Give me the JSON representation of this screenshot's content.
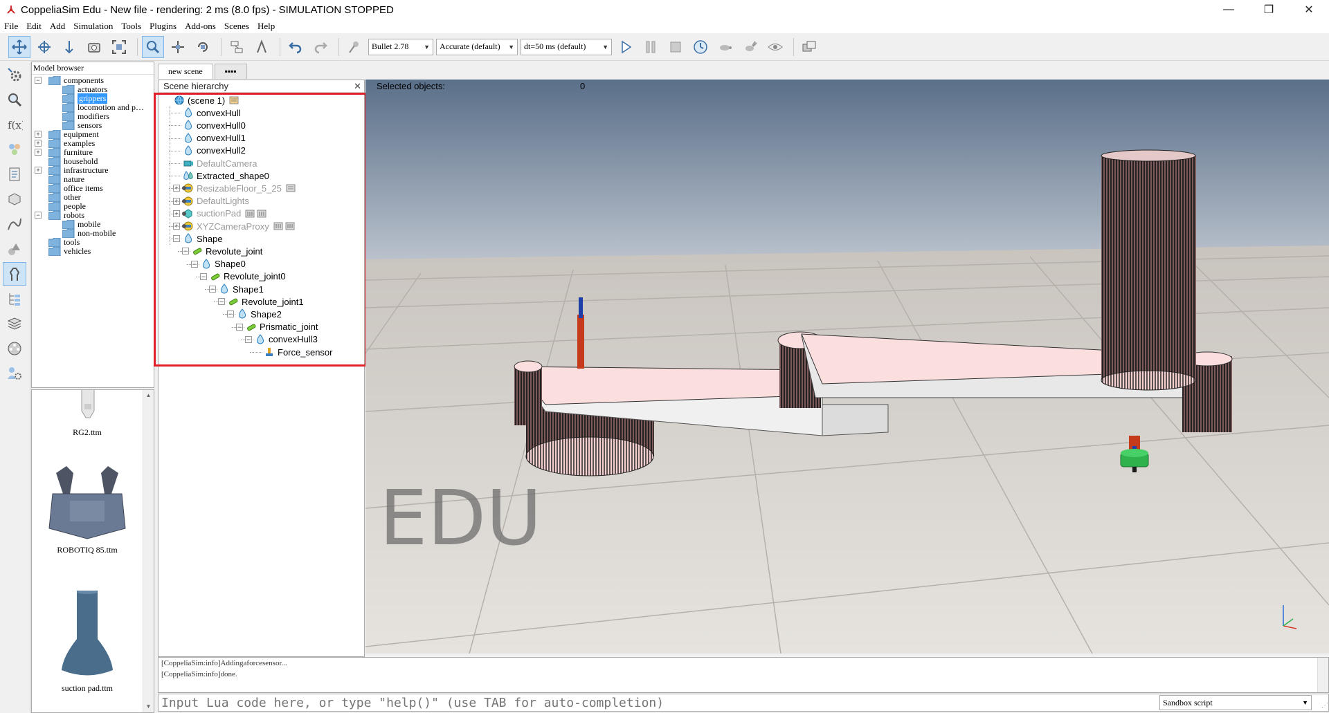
{
  "window": {
    "title": "CoppeliaSim Edu - New file - rendering: 2 ms (8.0 fps) - SIMULATION STOPPED",
    "minimize": "—",
    "maximize": "❐",
    "close": "✕"
  },
  "menu": [
    "File",
    "Edit",
    "Add",
    "Simulation",
    "Tools",
    "Plugins",
    "Add-ons",
    "Scenes",
    "Help"
  ],
  "toolbar": {
    "engine": "Bullet 2.78",
    "accuracy": "Accurate (default)",
    "timestep": "dt=50 ms (default)"
  },
  "model_browser": {
    "header": "Model browser",
    "items": [
      {
        "label": "components",
        "level": 0,
        "expanded": true
      },
      {
        "label": "actuators",
        "level": 1
      },
      {
        "label": "grippers",
        "level": 1,
        "selected": true
      },
      {
        "label": "locomotion and p…",
        "level": 1
      },
      {
        "label": "modifiers",
        "level": 1
      },
      {
        "label": "sensors",
        "level": 1
      },
      {
        "label": "equipment",
        "level": 0,
        "expander": "+"
      },
      {
        "label": "examples",
        "level": 0,
        "expander": "+"
      },
      {
        "label": "furniture",
        "level": 0,
        "expander": "+"
      },
      {
        "label": "household",
        "level": 0
      },
      {
        "label": "infrastructure",
        "level": 0,
        "expander": "+"
      },
      {
        "label": "nature",
        "level": 0
      },
      {
        "label": "office items",
        "level": 0
      },
      {
        "label": "other",
        "level": 0
      },
      {
        "label": "people",
        "level": 0
      },
      {
        "label": "robots",
        "level": 0,
        "expander": "-"
      },
      {
        "label": "mobile",
        "level": 1
      },
      {
        "label": "non-mobile",
        "level": 1
      },
      {
        "label": "tools",
        "level": 0
      },
      {
        "label": "vehicles",
        "level": 0
      }
    ]
  },
  "thumbnails": [
    {
      "label": "RG2.ttm"
    },
    {
      "label": "ROBOTIQ 85.ttm"
    },
    {
      "label": "suction pad.ttm"
    }
  ],
  "tabs": [
    {
      "label": "new scene",
      "active": true
    },
    {
      "label": "▪▪▪▪",
      "active": false
    }
  ],
  "scene_hierarchy": {
    "header": "Scene hierarchy",
    "items": [
      {
        "label": "(scene 1)",
        "depth": 0,
        "icon": "globe"
      },
      {
        "label": "convexHull",
        "depth": 1,
        "icon": "shape"
      },
      {
        "label": "convexHull0",
        "depth": 1,
        "icon": "shape"
      },
      {
        "label": "convexHull1",
        "depth": 1,
        "icon": "shape"
      },
      {
        "label": "convexHull2",
        "depth": 1,
        "icon": "shape"
      },
      {
        "label": "DefaultCamera",
        "depth": 1,
        "icon": "camera",
        "dim": true
      },
      {
        "label": "Extracted_shape0",
        "depth": 1,
        "icon": "shape-multi"
      },
      {
        "label": "ResizableFloor_5_25",
        "depth": 1,
        "icon": "model",
        "dim": true,
        "expander": "+"
      },
      {
        "label": "DefaultLights",
        "depth": 1,
        "icon": "model",
        "dim": true,
        "expander": "+"
      },
      {
        "label": "suctionPad",
        "depth": 1,
        "icon": "cube",
        "dim": true,
        "expander": "+"
      },
      {
        "label": "XYZCameraProxy",
        "depth": 1,
        "icon": "model",
        "dim": true,
        "expander": "+"
      },
      {
        "label": "Shape",
        "depth": 1,
        "icon": "shape",
        "expander": "-"
      },
      {
        "label": "Revolute_joint",
        "depth": 2,
        "icon": "joint",
        "expander": "-"
      },
      {
        "label": "Shape0",
        "depth": 3,
        "icon": "shape",
        "expander": "-"
      },
      {
        "label": "Revolute_joint0",
        "depth": 4,
        "icon": "joint",
        "expander": "-"
      },
      {
        "label": "Shape1",
        "depth": 5,
        "icon": "shape",
        "expander": "-"
      },
      {
        "label": "Revolute_joint1",
        "depth": 6,
        "icon": "joint",
        "expander": "-"
      },
      {
        "label": "Shape2",
        "depth": 7,
        "icon": "shape",
        "expander": "-"
      },
      {
        "label": "Prismatic_joint",
        "depth": 8,
        "icon": "joint",
        "expander": "-"
      },
      {
        "label": "convexHull3",
        "depth": 9,
        "icon": "shape",
        "expander": "-"
      },
      {
        "label": "Force_sensor",
        "depth": 10,
        "icon": "force-sensor"
      }
    ]
  },
  "viewport": {
    "selected_label": "Selected objects:",
    "selected_count": "0",
    "watermark": "EDU"
  },
  "console": {
    "lines": [
      "[CoppeliaSim:info]Addingaforcesensor...",
      "[CoppeliaSim:info]done."
    ]
  },
  "lua": {
    "placeholder": "Input Lua code here, or type \"help()\" (use TAB for auto-completion)",
    "script_type": "Sandbox script"
  },
  "colors": {
    "accent": "#3399ff",
    "highlight_frame": "#e0202a",
    "sky_top": "#5a6f89",
    "sky_bottom": "#c8ced6",
    "floor": "#cfcac4"
  }
}
